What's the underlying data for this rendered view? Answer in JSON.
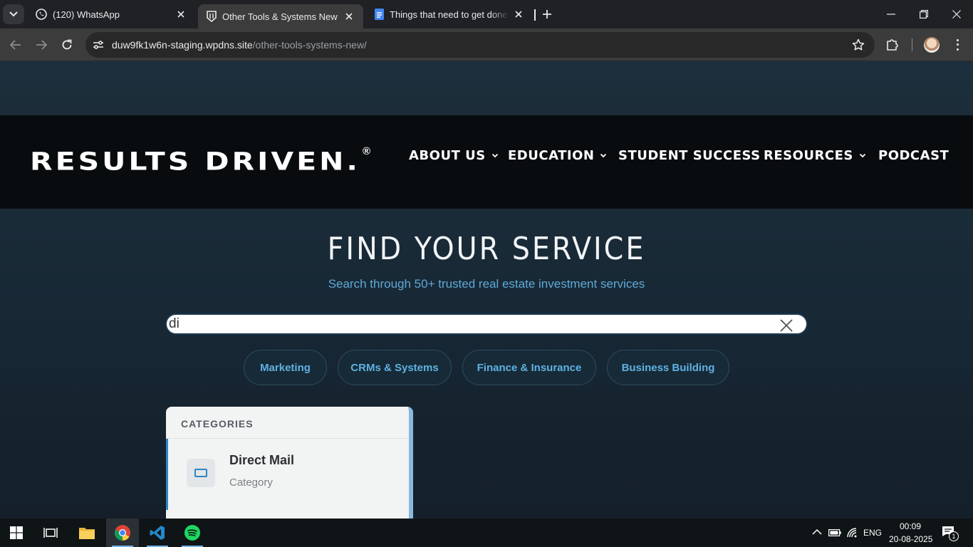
{
  "browser": {
    "tabs": [
      {
        "title": "(120) WhatsApp",
        "icon": "whatsapp-icon",
        "active": false
      },
      {
        "title": "Other Tools & Systems New | Re",
        "icon": "site-favicon",
        "active": true
      },
      {
        "title": "Things that need to get done - G",
        "icon": "google-docs-icon",
        "active": false
      }
    ],
    "url_domain": "duw9fk1w6n-staging.wpdns.site",
    "url_path": "/other-tools-systems-new/"
  },
  "site": {
    "logo_text": "RESULTS DRIVEN.",
    "logo_mark": "®",
    "nav": [
      {
        "label": "ABOUT US",
        "dropdown": true
      },
      {
        "label": "EDUCATION",
        "dropdown": true
      },
      {
        "label": "STUDENT SUCCESS",
        "dropdown": false
      },
      {
        "label": "RESOURCES",
        "dropdown": true
      },
      {
        "label": "PODCAST",
        "dropdown": false
      }
    ]
  },
  "hero": {
    "title": "FIND YOUR SERVICE",
    "subtitle": "Search through 50+ trusted real estate investment services"
  },
  "search": {
    "value": "di",
    "placeholder": ""
  },
  "filters": [
    "Marketing",
    "CRMs & Systems",
    "Finance & Insurance",
    "Business Building"
  ],
  "suggestions": {
    "heading": "CATEGORIES",
    "items": [
      {
        "name": "Direct Mail",
        "type": "Category",
        "icon": "mail-icon"
      }
    ]
  },
  "taskbar": {
    "apps": [
      "start-icon",
      "task-view-icon",
      "file-explorer-icon",
      "chrome-icon",
      "vscode-icon",
      "spotify-icon"
    ],
    "language": "ENG",
    "time": "00:09",
    "date": "20-08-2025",
    "notification_count": "1"
  },
  "colors": {
    "accent_blue": "#5fa9d6",
    "header_bg": "#090c0e",
    "page_bg": "#1a2b38",
    "chip_text": "#5fb1e0"
  }
}
